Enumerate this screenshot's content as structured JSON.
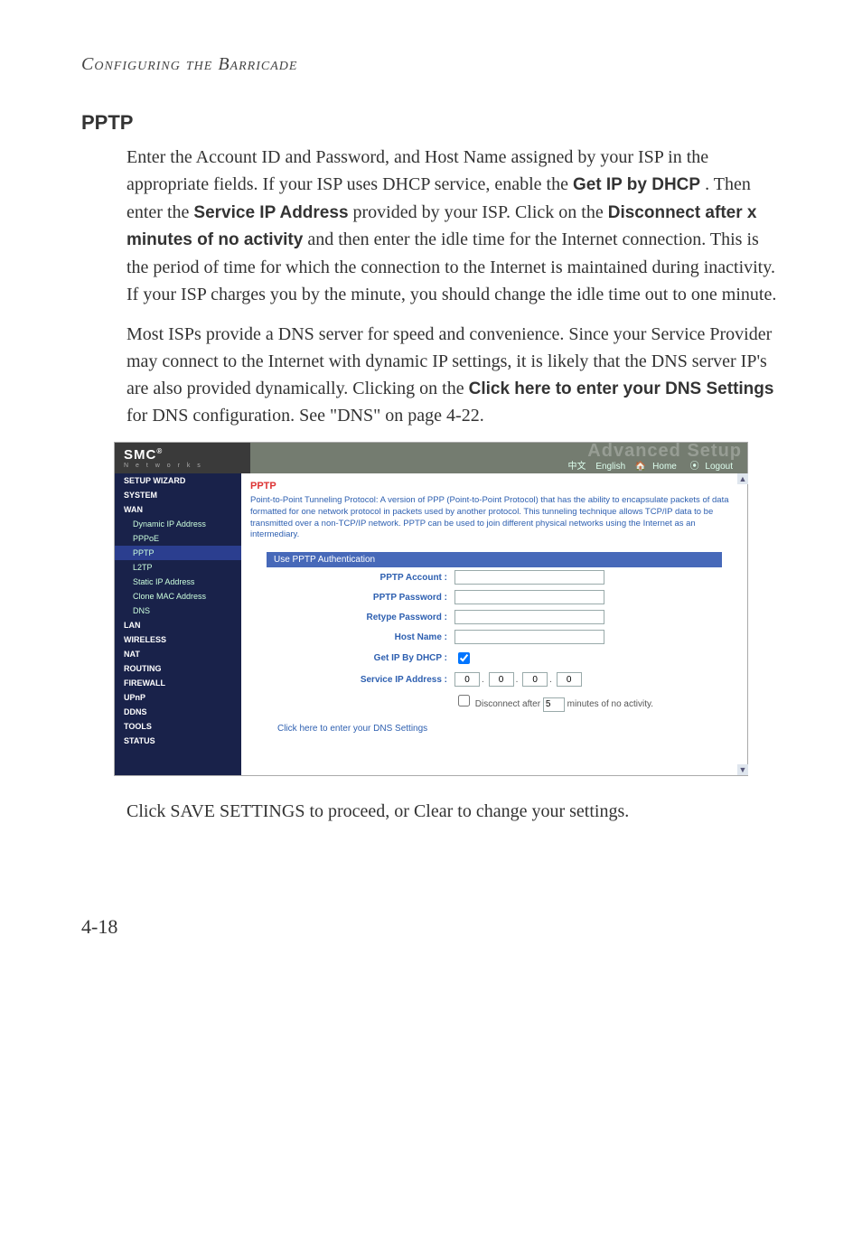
{
  "doc": {
    "running_head": "Configuring the Barricade",
    "page_number": "4-18",
    "section_title": "PPTP",
    "para1_pre": "Enter the Account ID and Password, and Host Name assigned by your ISP in the appropriate fields. If your ISP uses DHCP service, enable the ",
    "para1_b1": "Get IP by DHCP",
    "para1_mid1": ". Then enter the ",
    "para1_b2": "Service IP Address",
    "para1_mid2": " provided by your ISP. Click on the ",
    "para1_b3": "Disconnect after x minutes of no activity",
    "para1_post": " and then enter the idle time for the Internet connection. This is the period of time for which the connection to the Internet is maintained during inactivity. If your ISP charges you by the minute, you should change the idle time out to one minute.",
    "para2_pre": "Most ISPs provide a DNS server for speed and convenience. Since your Service Provider may connect to the Internet with dynamic IP settings, it is likely that the DNS server IP's are also provided dynamically. Clicking on the ",
    "para2_b1": "Click here to enter your DNS Settings",
    "para2_post": " for DNS configuration. See \"DNS\" on page 4-22.",
    "after_shot_pre": "Click ",
    "after_shot_b1": "SAVE SETTINGS",
    "after_shot_mid": " to proceed, or ",
    "after_shot_b2": "Clear",
    "after_shot_post": " to change your settings."
  },
  "shot": {
    "brand": "SMC",
    "brand_sup": "®",
    "networks": "N e t w o r k s",
    "ghost": "Advanced Setup",
    "lang_cn": "中文",
    "lang_en": "English",
    "home": "Home",
    "logout": "Logout",
    "sidebar": {
      "setup_wizard": "SETUP WIZARD",
      "system": "SYSTEM",
      "wan": "WAN",
      "wan_dynamic": "Dynamic IP Address",
      "wan_pppoe": "PPPoE",
      "wan_pptp": "PPTP",
      "wan_l2tp": "L2TP",
      "wan_static": "Static IP Address",
      "wan_clone": "Clone MAC Address",
      "wan_dns": "DNS",
      "lan": "LAN",
      "wireless": "WIRELESS",
      "nat": "NAT",
      "routing": "ROUTING",
      "firewall": "FIREWALL",
      "upnp": "UPnP",
      "ddns": "DDNS",
      "tools": "TOOLS",
      "status": "STATUS"
    },
    "content": {
      "title": "PPTP",
      "desc": "Point-to-Point Tunneling Protocol: A version of PPP (Point-to-Point Protocol) that has the ability to encapsulate packets of data formatted for one network protocol in packets used by another protocol. This tunneling technique allows TCP/IP data to be transmitted over a non-TCP/IP network. PPTP can be used to join different physical networks using the Internet as an intermediary.",
      "form_header": "Use PPTP Authentication",
      "lbl_account": "PPTP Account :",
      "lbl_password": "PPTP Password :",
      "lbl_retype": "Retype Password :",
      "lbl_host": "Host Name :",
      "lbl_getip": "Get IP By DHCP :",
      "lbl_service": "Service IP Address :",
      "ip1": "0",
      "ip2": "0",
      "ip3": "0",
      "ip4": "0",
      "disc_pre": "Disconnect after ",
      "disc_val": "5",
      "disc_post": " minutes of no activity.",
      "dns_link": "Click here to enter your DNS Settings"
    }
  }
}
